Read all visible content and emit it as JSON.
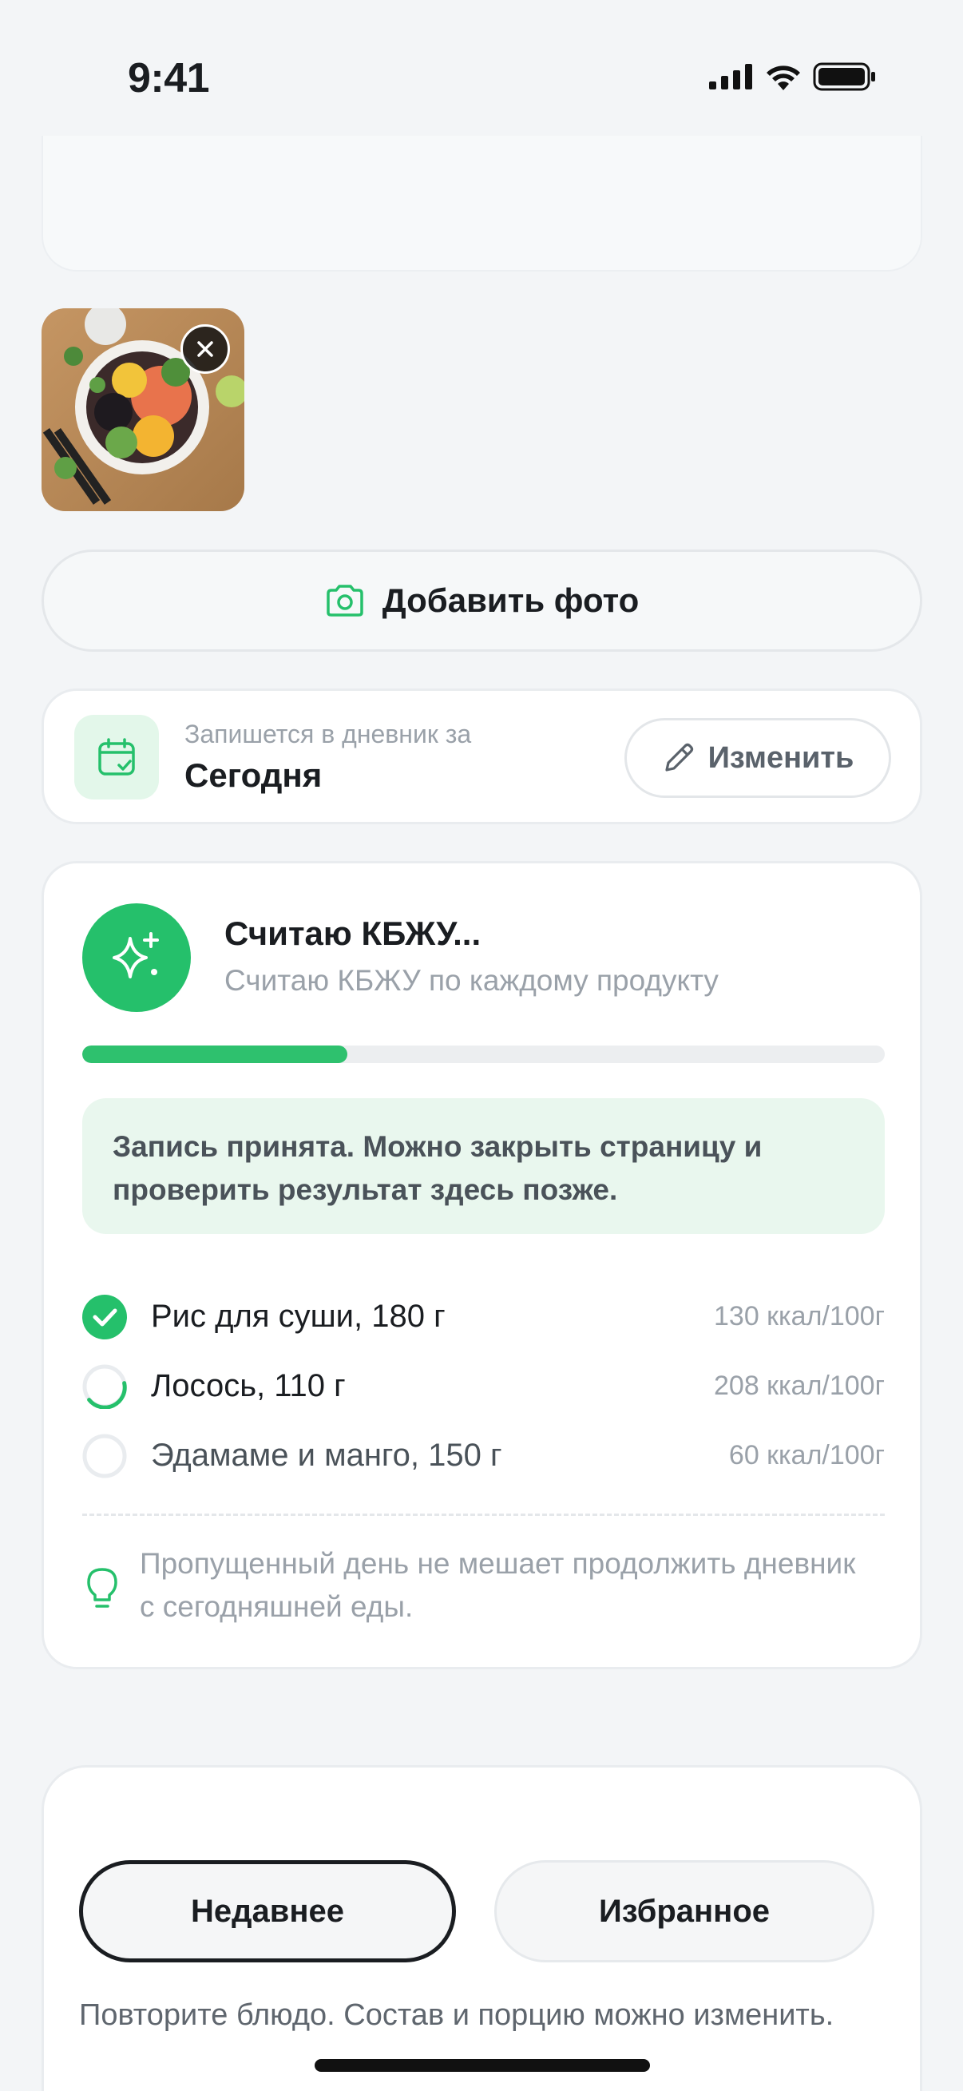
{
  "status_bar": {
    "time": "9:41",
    "icons": [
      "cellular-signal-icon",
      "wifi-icon",
      "battery-icon"
    ]
  },
  "photo": {
    "description_icon": "food-bowl-photo",
    "remove_icon": "close-icon"
  },
  "add_photo": {
    "icon": "camera-icon",
    "label": "Добавить фото"
  },
  "date_card": {
    "icon": "calendar-check-icon",
    "caption": "Запишется в дневник за",
    "value": "Сегодня",
    "edit_icon": "pencil-icon",
    "edit_label": "Изменить"
  },
  "analysis": {
    "icon": "sparkles-icon",
    "title": "Считаю КБЖУ...",
    "subtitle": "Считаю КБЖУ по каждому продукту",
    "progress": 0.33,
    "notice": "Запись принята. Можно закрыть страницу и проверить результат здесь позже.",
    "ingredients": [
      {
        "name": "Рис для суши, 180 г",
        "kcal": "130 ккал/100г",
        "status": "done"
      },
      {
        "name": "Лосось, 110 г",
        "kcal": "208 ккал/100г",
        "status": "in-progress"
      },
      {
        "name": "Эдамаме и манго, 150 г",
        "kcal": "60 ккал/100г",
        "status": "pending"
      }
    ],
    "tip_icon": "lightbulb-icon",
    "tip": "Пропущенный день не мешает продолжить дневник с сегодняшней еды."
  },
  "bottom_sheet": {
    "tabs": [
      {
        "label": "Недавнее",
        "active": true
      },
      {
        "label": "Избранное",
        "active": false
      }
    ],
    "description": "Повторите блюдо. Состав и порцию можно изменить."
  },
  "colors": {
    "accent": "#25c06b",
    "accent_light": "#e3f7ea",
    "background": "#f3f5f7",
    "text_primary": "#1a1d21",
    "text_muted": "#9aa1a9"
  }
}
